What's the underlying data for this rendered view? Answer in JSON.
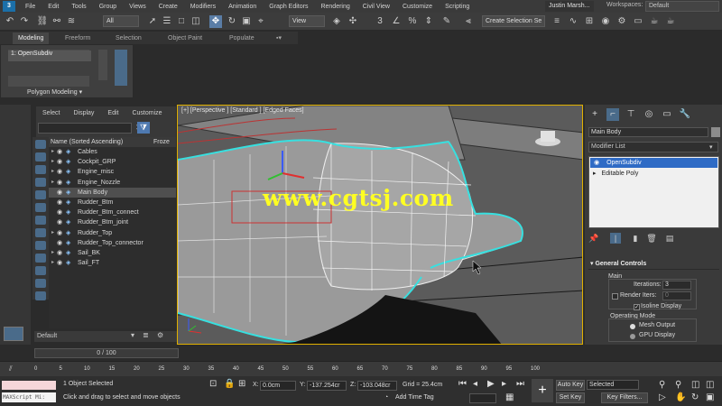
{
  "menu": {
    "logo": "3",
    "items": [
      "File",
      "Edit",
      "Tools",
      "Group",
      "Views",
      "Create",
      "Modifiers",
      "Animation",
      "Graph Editors",
      "Rendering",
      "Civil View",
      "Customize",
      "Scripting"
    ],
    "user": "Justin Marsh...",
    "workspaces_label": "Workspaces:",
    "workspaces_value": "Default"
  },
  "toolbar": {
    "filter_value": "All",
    "refcoord_value": "View",
    "selection_set_placeholder": "Create Selection Se"
  },
  "ribbon": {
    "tabs": [
      "Modeling",
      "Freeform",
      "Selection",
      "Object Paint",
      "Populate"
    ],
    "active_tab": "Modeling",
    "stack_item": "1: OpenSubdiv",
    "title": "Polygon Modeling ▾"
  },
  "scene_explorer": {
    "menu": [
      "Select",
      "Display",
      "Edit",
      "Customize"
    ],
    "column_header": "Name (Sorted Ascending)",
    "frozen_header": "Froze",
    "rows": [
      {
        "name": "Cables",
        "expandable": true,
        "selected": false
      },
      {
        "name": "Cockpit_GRP",
        "expandable": true,
        "selected": false
      },
      {
        "name": "Engine_misc",
        "expandable": true,
        "selected": false
      },
      {
        "name": "Engine_Nozzle",
        "expandable": true,
        "selected": false
      },
      {
        "name": "Main Body",
        "expandable": false,
        "selected": true
      },
      {
        "name": "Rudder_Btm",
        "expandable": false,
        "selected": false
      },
      {
        "name": "Rudder_Btm_connect",
        "expandable": false,
        "selected": false
      },
      {
        "name": "Rudder_Btm_joint",
        "expandable": false,
        "selected": false
      },
      {
        "name": "Rudder_Top",
        "expandable": true,
        "selected": false
      },
      {
        "name": "Rudder_Top_connector",
        "expandable": false,
        "selected": false
      },
      {
        "name": "Sail_BK",
        "expandable": true,
        "selected": false
      },
      {
        "name": "Sail_FT",
        "expandable": true,
        "selected": false
      }
    ],
    "layer": "Default"
  },
  "viewport": {
    "label": "[+] [Perspective ] [Standard ] [Edged Faces]",
    "watermark": "www.cgtsj.com"
  },
  "command_panel": {
    "object_name": "Main Body",
    "modifier_list": "Modifier List",
    "stack": [
      {
        "name": "OpenSubdiv",
        "selected": true
      },
      {
        "name": "Editable Poly",
        "selected": false
      }
    ],
    "rollout_title": "General Controls",
    "main_group": "Main",
    "iterations_label": "Iterations:",
    "iterations_value": "3",
    "render_iters_label": "Render Iters:",
    "render_iters_value": "0",
    "isoline_label": "Isoline Display",
    "isoline_checked": true,
    "operating_mode_label": "Operating Mode",
    "mode_options": [
      "Mesh Output",
      "GPU Display"
    ],
    "mode_selected": "Mesh Output"
  },
  "timeline": {
    "slider_label": "0 / 100",
    "tick_labels": [
      "0",
      "5",
      "10",
      "15",
      "20",
      "25",
      "30",
      "35",
      "40",
      "45",
      "50",
      "55",
      "60",
      "65",
      "70",
      "75",
      "80",
      "85",
      "90",
      "95",
      "100"
    ]
  },
  "status": {
    "maxscript": "MAXScript Mi:",
    "selection_info": "1 Object Selected",
    "prompt": "Click and drag to select and move objects",
    "x_label": "X:",
    "x_value": "0.0cm",
    "y_label": "Y:",
    "y_value": "-137.254cr",
    "z_label": "Z:",
    "z_value": "-103.048cr",
    "grid": "Grid = 25.4cm",
    "add_time_tag": "Add Time Tag",
    "auto_key": "Auto Key",
    "set_key": "Set Key",
    "key_select_value": "Selected",
    "key_filters": "Key Filters..."
  }
}
